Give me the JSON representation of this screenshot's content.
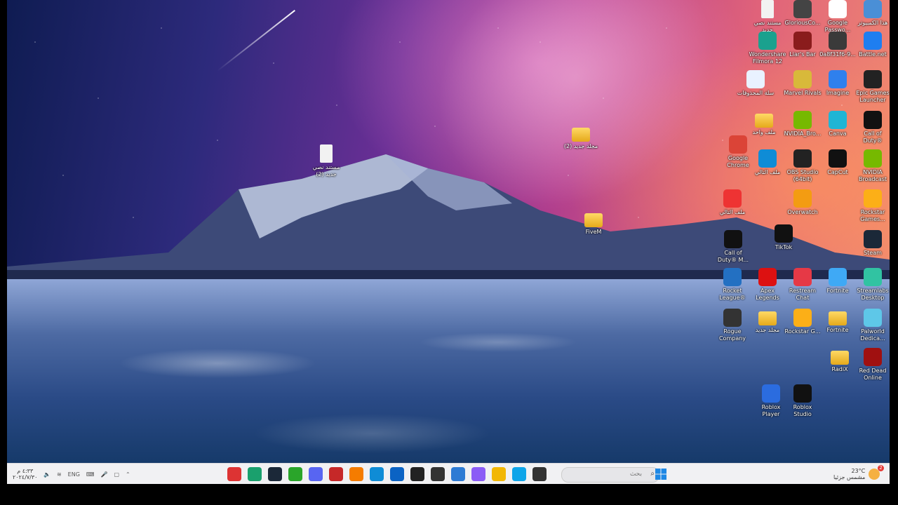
{
  "desktop_icons": [
    {
      "name": "new-text-doc-icon",
      "label": "مستند نصي جديد",
      "color": "#f2f2f2",
      "kind": "file"
    },
    {
      "name": "glorious-icon",
      "label": "GloriousCo...",
      "color": "#444",
      "kind": "app"
    },
    {
      "name": "google-passwords-icon",
      "label": "Google Passwo...",
      "color": "#ffffff",
      "kind": "app"
    },
    {
      "name": "this-pc-icon",
      "label": "هذا الكمبيوتر",
      "color": "#4a8fd6",
      "kind": "app"
    },
    {
      "name": "filmora-icon",
      "label": "Wondershare Filmora 12",
      "color": "#1aa18e",
      "kind": "app"
    },
    {
      "name": "liars-bar-icon",
      "label": "Liar's Bar",
      "color": "#8a1c1c",
      "kind": "app"
    },
    {
      "name": "hash-file-icon",
      "label": "0a8f31f6-9...",
      "color": "#3a3a3a",
      "kind": "app"
    },
    {
      "name": "battlenet-icon",
      "label": "Battle.net",
      "color": "#1e7ef0",
      "kind": "app"
    },
    {
      "name": "recycle-bin-icon",
      "label": "سلة المحذوفات",
      "color": "#e9f2ff",
      "kind": "app"
    },
    {
      "name": "marvel-rivals-icon",
      "label": "Marvel Rivals",
      "color": "#d8b93a",
      "kind": "app"
    },
    {
      "name": "imagine-icon",
      "label": "Imagine",
      "color": "#2f80ed",
      "kind": "app"
    },
    {
      "name": "epic-games-icon",
      "label": "Epic Games Launcher",
      "color": "#222",
      "kind": "app"
    },
    {
      "name": "folder-files-icon",
      "label": "ملف واحد",
      "color": "#e5a91a",
      "kind": "folder"
    },
    {
      "name": "nvidia-broadcast-icon",
      "label": "NVIDIA_Bro...",
      "color": "#76b900",
      "kind": "app"
    },
    {
      "name": "canva-icon",
      "label": "Canva",
      "color": "#1fb5d5",
      "kind": "app"
    },
    {
      "name": "cod-duty-icon",
      "label": "Call of Duty®",
      "color": "#111",
      "kind": "app"
    },
    {
      "name": "chrome-icon",
      "label": "Google Chrome",
      "color": "#db4437",
      "kind": "app"
    },
    {
      "name": "edge-icon",
      "label": "ملف التالي",
      "color": "#0f8cd6",
      "kind": "app"
    },
    {
      "name": "obs-icon",
      "label": "OBS Studio (64bit)",
      "color": "#222",
      "kind": "app"
    },
    {
      "name": "capcut-icon",
      "label": "CapCut",
      "color": "#111",
      "kind": "app"
    },
    {
      "name": "nvidia-broadcast-2-icon",
      "label": "NVIDIA Broadcast",
      "color": "#76b900",
      "kind": "app"
    },
    {
      "name": "pdf-icon",
      "label": "ملف التالي",
      "color": "#e33",
      "kind": "app"
    },
    {
      "name": "overwatch-icon",
      "label": "Overwatch",
      "color": "#f39c12",
      "kind": "app"
    },
    {
      "name": "rockstar-icon",
      "label": "Rockstar Games...",
      "color": "#fcaf17",
      "kind": "app"
    },
    {
      "name": "cod-mw-icon",
      "label": "Call of Duty® M...",
      "color": "#111",
      "kind": "app"
    },
    {
      "name": "tiktok-icon",
      "label": "TikTok",
      "color": "#111",
      "kind": "app"
    },
    {
      "name": "steam-icon",
      "label": "Steam",
      "color": "#1b2838",
      "kind": "app"
    },
    {
      "name": "rocket-league-icon",
      "label": "Rocket League®",
      "color": "#2370c2",
      "kind": "app"
    },
    {
      "name": "apex-icon",
      "label": "Apex Legends",
      "color": "#d11",
      "kind": "app"
    },
    {
      "name": "restream-icon",
      "label": "Restream Chat",
      "color": "#e63946",
      "kind": "app"
    },
    {
      "name": "fortnite-icon",
      "label": "Fortnite",
      "color": "#3fa9f5",
      "kind": "app"
    },
    {
      "name": "streamlabs-icon",
      "label": "Streamlabs Desktop",
      "color": "#31c3a2",
      "kind": "app"
    },
    {
      "name": "rogue-company-icon",
      "label": "Rogue Company",
      "color": "#333",
      "kind": "app"
    },
    {
      "name": "new-folder-icon",
      "label": "مجلد جديد",
      "color": "#e5a91a",
      "kind": "folder"
    },
    {
      "name": "rockstar-games-icon",
      "label": "Rockstar G...",
      "color": "#fcaf17",
      "kind": "app"
    },
    {
      "name": "fortnite-folder-icon",
      "label": "Fortnite",
      "color": "#e5a91a",
      "kind": "folder"
    },
    {
      "name": "palworld-icon",
      "label": "Palworld Dedica...",
      "color": "#5ec7e8",
      "kind": "app"
    },
    {
      "name": "radix-folder-icon",
      "label": "RadiX",
      "color": "#e5a91a",
      "kind": "folder"
    },
    {
      "name": "red-dead-icon",
      "label": "Red Dead Online",
      "color": "#a01010",
      "kind": "app"
    },
    {
      "name": "roblox-player-icon",
      "label": "Roblox Player",
      "color": "#2b6cdf",
      "kind": "app"
    },
    {
      "name": "roblox-studio-icon",
      "label": "Roblox Studio",
      "color": "#111",
      "kind": "app"
    },
    {
      "name": "desktop-file-icon",
      "label": "مستند نصي جديد (2)",
      "color": "#f2f2f2",
      "kind": "file"
    },
    {
      "name": "desktop-new-folder-icon",
      "label": "مجلد جديد (2)",
      "color": "#e5a91a",
      "kind": "folder"
    },
    {
      "name": "fivem-folder-icon",
      "label": "FiveM",
      "color": "#e5a91a",
      "kind": "folder"
    }
  ],
  "taskbar": {
    "apps": [
      {
        "name": "app-red-icon",
        "color": "#d33"
      },
      {
        "name": "app-green-icon",
        "color": "#1aa06d"
      },
      {
        "name": "steam-task-icon",
        "color": "#1b2838"
      },
      {
        "name": "xbox-task-icon",
        "color": "#2aa52a"
      },
      {
        "name": "discord-task-icon",
        "color": "#5865f2"
      },
      {
        "name": "app-red2-icon",
        "color": "#c62828"
      },
      {
        "name": "app-orange-icon",
        "color": "#f57c00"
      },
      {
        "name": "edge-task-icon",
        "color": "#0f8cd6"
      },
      {
        "name": "outlook-task-icon",
        "color": "#0b63c4"
      },
      {
        "name": "capcut-task-icon",
        "color": "#222"
      },
      {
        "name": "obs-task-icon",
        "color": "#333"
      },
      {
        "name": "store-task-icon",
        "color": "#2e7bd4"
      },
      {
        "name": "copilot-task-icon",
        "color": "#8b5cf6"
      },
      {
        "name": "explorer-task-icon",
        "color": "#f2b705"
      },
      {
        "name": "chrome-edge-task-icon",
        "color": "#0ea5e9"
      },
      {
        "name": "terminal-task-icon",
        "color": "#333"
      }
    ],
    "search_placeholder": "بحث",
    "language": "ENG",
    "time": "٤:٣٣ م",
    "date": "٢٠٢٤/٧/٣٠",
    "weather_temp": "23°C",
    "weather_desc": "مشمس جزئيا",
    "notification_count": "2"
  }
}
